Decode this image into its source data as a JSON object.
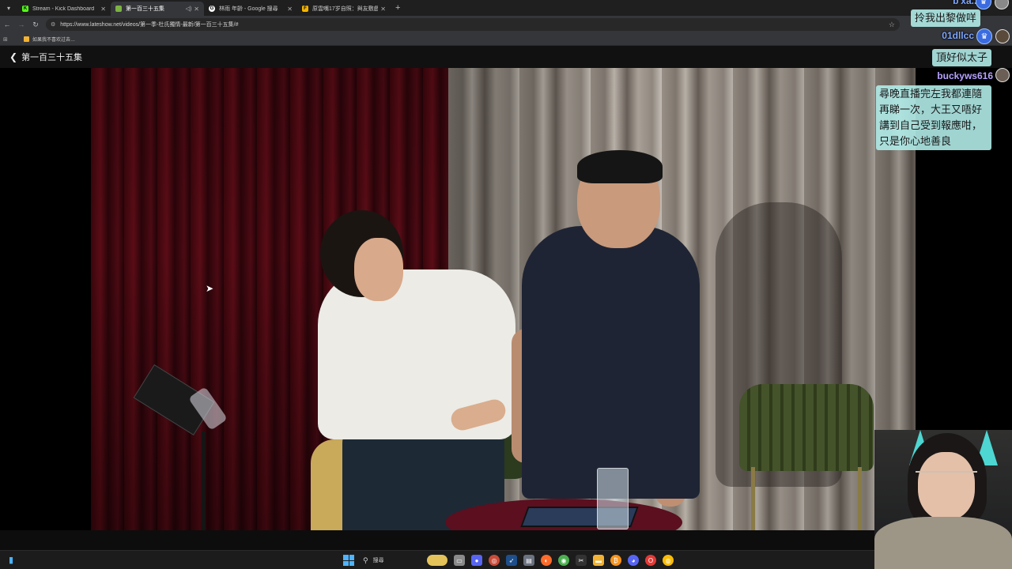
{
  "browser": {
    "tabs": [
      {
        "title": "Stream - Kick Dashboard",
        "favicon": "kick-logo",
        "favicon_color": "#53fc18",
        "active": false
      },
      {
        "title": "第一百三十五集",
        "favicon": "site-logo",
        "favicon_color": "#7cb342",
        "active": true,
        "audio": true
      },
      {
        "title": "林雨 年齡 - Google 搜尋",
        "favicon": "google-logo",
        "favicon_color": "#ffffff",
        "active": false
      },
      {
        "title": "原雲嘴17岁自照：與友敷戲山…",
        "favicon": "news-logo",
        "favicon_color": "#f5b400",
        "active": false
      }
    ],
    "url": "https://www.lateshow.net/videos/第一季-杜氏獨情-最新/第一百三十五集/#",
    "bookmarks": [
      {
        "label": "如果我不喜欢过去…"
      }
    ]
  },
  "page": {
    "back_label": "第一百三十五集"
  },
  "chat": {
    "clipped_name": "b'xa..x",
    "messages": [
      {
        "text": "拎我出黎做咩"
      },
      {
        "text": "頂好似太子"
      }
    ],
    "users": [
      {
        "name": "01dllcc",
        "color": "#7fa7ff"
      },
      {
        "name": "buckyws616",
        "color": "#b7a2ff"
      }
    ],
    "long_message": {
      "lines": [
        "尋晚直播完左我都連隨",
        "再睇一次，大王又唔好",
        "講到自己受到報應咁，",
        "只是你心地善良"
      ]
    }
  },
  "taskbar": {
    "search_label": "搜尋",
    "apps": [
      "file-explorer-icon",
      "chat-icon",
      "steam-icon",
      "photos-icon",
      "firefox-icon",
      "chrome-icon",
      "capcut-icon",
      "folder-icon",
      "bitcoin-icon",
      "discord-icon",
      "opera-icon",
      "chrome-canary-icon"
    ]
  }
}
